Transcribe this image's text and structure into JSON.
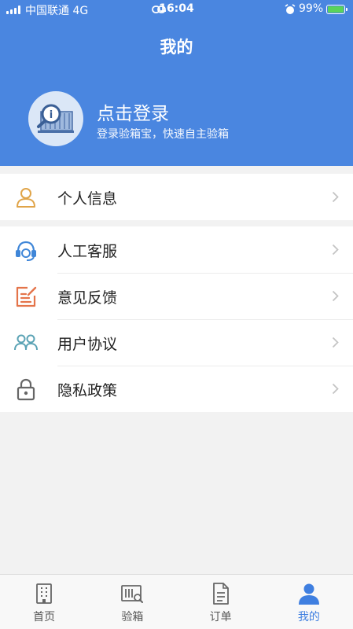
{
  "status_bar": {
    "carrier": "中国联通  4G",
    "time": "16:04",
    "battery": "99%"
  },
  "header": {
    "title": "我的",
    "login_title": "点击登录",
    "login_subtitle": "登录验箱宝，快速自主验箱"
  },
  "menu": {
    "group1": [
      {
        "label": "个人信息",
        "icon": "person-icon"
      }
    ],
    "group2": [
      {
        "label": "人工客服",
        "icon": "headset-icon"
      },
      {
        "label": "意见反馈",
        "icon": "feedback-edit-icon"
      },
      {
        "label": "用户协议",
        "icon": "users-icon"
      },
      {
        "label": "隐私政策",
        "icon": "lock-icon"
      }
    ]
  },
  "tabbar": {
    "items": [
      {
        "label": "首页",
        "icon": "building-icon"
      },
      {
        "label": "验箱",
        "icon": "container-inspect-icon"
      },
      {
        "label": "订单",
        "icon": "document-icon"
      },
      {
        "label": "我的",
        "icon": "user-icon"
      }
    ],
    "active_index": 3,
    "accent_color": "#3f7fe0"
  },
  "colors": {
    "header_bg": "#4a86e0",
    "page_bg": "#f2f2f2"
  }
}
